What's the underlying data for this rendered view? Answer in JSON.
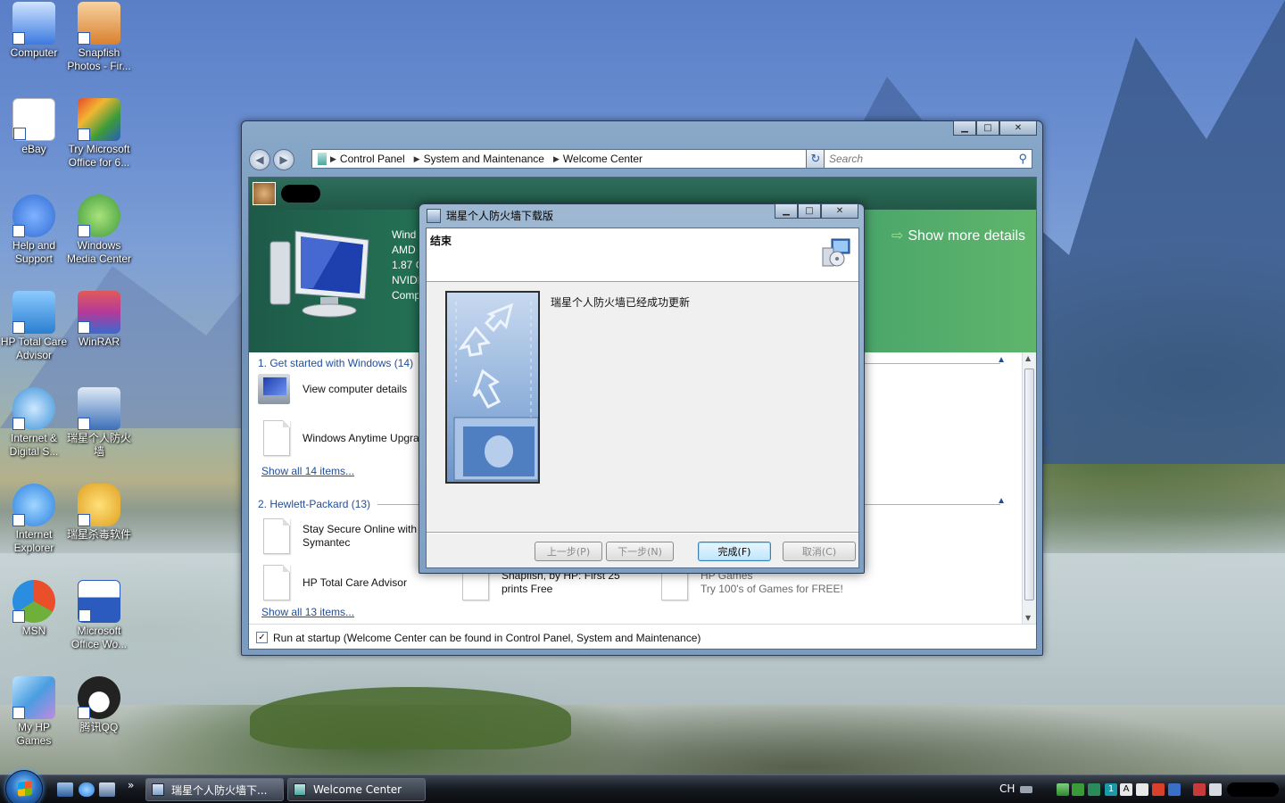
{
  "desktop": {
    "icons": [
      {
        "label": "Computer",
        "icon": "computer-icon",
        "color": "#3c7be0"
      },
      {
        "label": "Snapfish Photos - Fir...",
        "icon": "camera-icon",
        "color": "#d9812e"
      },
      {
        "label": "eBay",
        "icon": "ebay-icon",
        "color": "#ffffff"
      },
      {
        "label": "Try Microsoft Office for 6...",
        "icon": "office-icon",
        "color": "#d94a2a"
      },
      {
        "label": "Help and Support",
        "icon": "help-icon",
        "color": "#2f6bd3"
      },
      {
        "label": "Windows Media Center",
        "icon": "media-center-icon",
        "color": "#3d9a3d"
      },
      {
        "label": "HP Total Care Advisor",
        "icon": "hp-care-icon",
        "color": "#2a7fd0"
      },
      {
        "label": "WinRAR",
        "icon": "winrar-icon",
        "color": "#b33a9a"
      },
      {
        "label": "Internet & Digital S...",
        "icon": "internet-digital-icon",
        "color": "#3a8fd8"
      },
      {
        "label": "瑞星个人防火墙",
        "icon": "firewall-icon",
        "color": "#3b6fb8"
      },
      {
        "label": "Internet Explorer",
        "icon": "ie-icon",
        "color": "#2a7fe0"
      },
      {
        "label": "瑞星杀毒软件",
        "icon": "antivirus-icon",
        "color": "#e0a020"
      },
      {
        "label": "MSN",
        "icon": "msn-icon",
        "color": "#6fb03a"
      },
      {
        "label": "Microsoft Office Wo...",
        "icon": "word-icon",
        "color": "#2b5bbf"
      },
      {
        "label": "My HP Games",
        "icon": "hp-games-icon",
        "color": "#4a9de0"
      },
      {
        "label": "腾讯QQ",
        "icon": "qq-icon",
        "color": "#222222"
      }
    ]
  },
  "welcome_window": {
    "breadcrumb": [
      "Control Panel",
      "System and Maintenance",
      "Welcome Center"
    ],
    "search_placeholder": "Search",
    "header": {
      "sysinfo": [
        "Wind",
        "AMD",
        "1.87 G",
        "NVIDI",
        "Comp"
      ],
      "show_more": "Show more details"
    },
    "sections": [
      {
        "title": "1. Get started with Windows (14)",
        "items": [
          {
            "label": "View computer details"
          },
          {
            "label": "Windows Anytime Upgra"
          }
        ],
        "show_all": "Show all 14 items..."
      },
      {
        "title": "2. Hewlett-Packard (13)",
        "items": [
          {
            "label": "Stay Secure Online with",
            "label2": "Symantec"
          },
          {
            "label": "HP Total Care Advisor"
          },
          {
            "label": "Snapfish, by HP: First 25",
            "label2": "prints Free"
          },
          {
            "label": "HP Games",
            "label2": "Try 100's of Games for FREE!"
          }
        ],
        "show_all": "Show all 13 items..."
      }
    ],
    "footer_checkbox": "Run at startup (Welcome Center can be found in Control Panel, System and Maintenance)",
    "footer_checked": true
  },
  "firewall_dialog": {
    "title": "瑞星个人防火墙下载版",
    "heading": "结束",
    "message": "瑞星个人防火墙已经成功更新",
    "buttons": {
      "back": "上一步(P)",
      "next": "下一步(N)",
      "finish": "完成(F)",
      "cancel": "取消(C)"
    }
  },
  "taskbar": {
    "tasks": [
      {
        "label": "瑞星个人防火墙下...",
        "active": true
      },
      {
        "label": "Welcome Center",
        "active": false
      }
    ],
    "language": "CH",
    "overflow_chevron": "»"
  }
}
